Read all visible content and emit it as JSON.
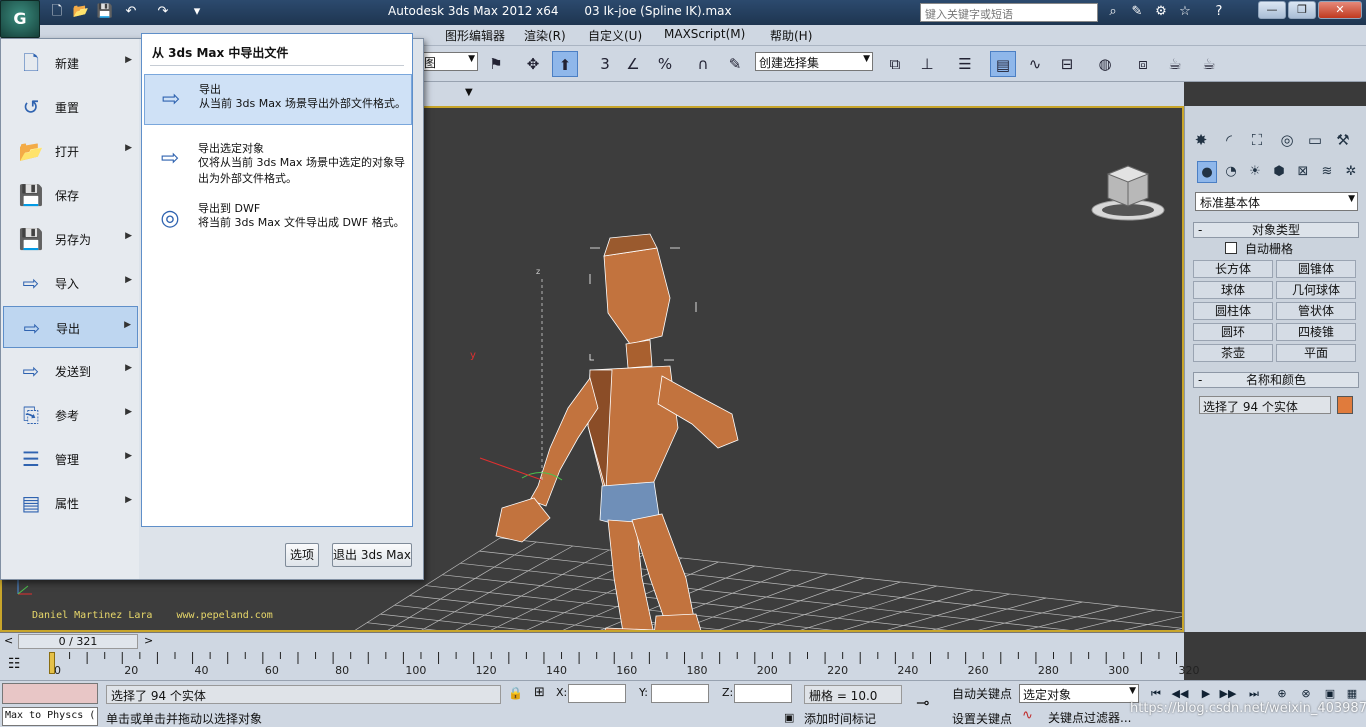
{
  "titlebar": {
    "app_title": "Autodesk 3ds Max  2012 x64",
    "file_title": "03 Ik-joe (Spline IK).max",
    "search_placeholder": "键入关键字或短语",
    "qa_icons": [
      "new-icon",
      "open-icon",
      "save-icon",
      "undo-icon",
      "redo-icon",
      "dropdown-icon"
    ],
    "window_buttons": [
      "minimize-icon",
      "restore-icon",
      "close-icon"
    ]
  },
  "menubar": {
    "items": [
      "图形编辑器",
      "渲染(R)",
      "自定义(U)",
      "MAXScript(M)",
      "帮助(H)"
    ]
  },
  "toolbar": {
    "view_dropdown": "图",
    "selection_set_placeholder": "创建选择集",
    "snap_labels": [
      "3",
      "%"
    ]
  },
  "app_menu": {
    "items": [
      {
        "label": "新建",
        "icon": "new-doc-icon",
        "has_submenu": true
      },
      {
        "label": "重置",
        "icon": "reset-icon",
        "has_submenu": false
      },
      {
        "label": "打开",
        "icon": "folder-open-icon",
        "has_submenu": true
      },
      {
        "label": "保存",
        "icon": "save-icon",
        "has_submenu": false
      },
      {
        "label": "另存为",
        "icon": "save-as-icon",
        "has_submenu": true
      },
      {
        "label": "导入",
        "icon": "import-icon",
        "has_submenu": true
      },
      {
        "label": "导出",
        "icon": "export-icon",
        "has_submenu": true,
        "selected": true
      },
      {
        "label": "发送到",
        "icon": "send-to-icon",
        "has_submenu": true
      },
      {
        "label": "参考",
        "icon": "reference-icon",
        "has_submenu": true
      },
      {
        "label": "管理",
        "icon": "manage-icon",
        "has_submenu": true
      },
      {
        "label": "属性",
        "icon": "properties-icon",
        "has_submenu": true
      }
    ],
    "submenu": {
      "title": "从 3ds Max 中导出文件",
      "items": [
        {
          "title": "导出",
          "desc": "从当前 3ds Max 场景导出外部文件格式。",
          "icon": "export-icon",
          "selected": true
        },
        {
          "title": "导出选定对象",
          "desc": "仅将从当前 3ds Max 场景中选定的对象导出为外部文件格式。",
          "icon": "export-selected-icon",
          "selected": false
        },
        {
          "title": "导出到 DWF",
          "desc": "将当前 3ds Max 文件导出成 DWF 格式。",
          "icon": "export-dwf-icon",
          "selected": false
        }
      ]
    },
    "options_button": "选项",
    "exit_button": "退出 3ds Max"
  },
  "viewport": {
    "credits": "Daniel Martinez Lara    www.pepeland.com",
    "axis_labels": [
      "y",
      "z"
    ],
    "border_color": "#c8a52a",
    "character_color": "#c2733e"
  },
  "command_panel": {
    "category": "标准基本体",
    "rollout_object_type": "对象类型",
    "autogrid_label": "自动栅格",
    "primitives": [
      "长方体",
      "圆锥体",
      "球体",
      "几何球体",
      "圆柱体",
      "管状体",
      "圆环",
      "四棱锥",
      "茶壶",
      "平面"
    ],
    "rollout_name_color": "名称和颜色",
    "name_field": "选择了 94 个实体",
    "object_color": "#e07b3c",
    "rollout_minus": "-"
  },
  "timeline": {
    "frame_display": "0 / 321",
    "prev": "<",
    "next": ">",
    "total_frames": 321,
    "tick_labels": [
      "0",
      "20",
      "40",
      "60",
      "80",
      "100",
      "120",
      "140",
      "160",
      "180",
      "200",
      "220",
      "240",
      "260",
      "280",
      "300",
      "320"
    ]
  },
  "status": {
    "script_line": "Max to Physcs (",
    "selection_msg": "选择了 94 个实体",
    "prompt_msg": "单击或单击并拖动以选择对象",
    "x_label": "X:",
    "y_label": "Y:",
    "z_label": "Z:",
    "grid_text": "栅格 = 10.0",
    "add_time_tag": "添加时间标记",
    "auto_key": "自动关键点",
    "set_key": "设置关键点",
    "selection_filter": "选定对象",
    "key_filter": "关键点过滤器...",
    "watermark": "https://blog.csdn.net/weixin_40398702"
  }
}
